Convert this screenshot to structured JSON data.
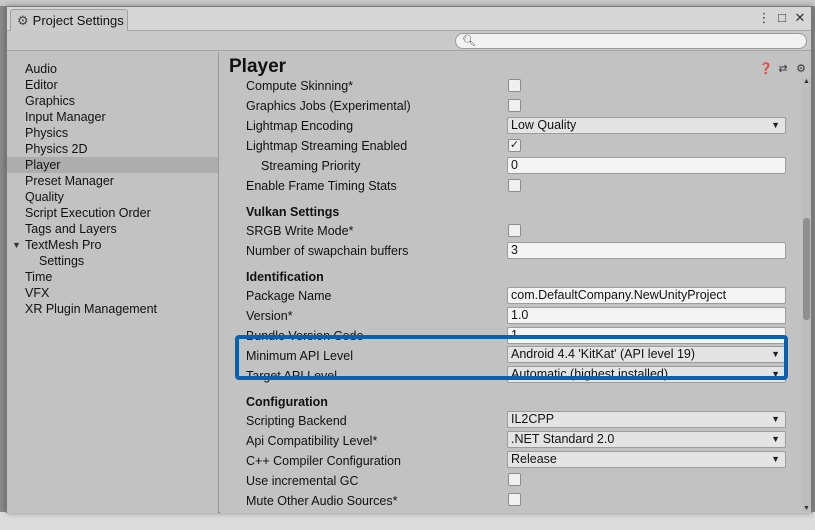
{
  "window": {
    "title": "Project Settings",
    "buttons": [
      "⋮",
      "□",
      "✕"
    ]
  },
  "search": {
    "placeholder": ""
  },
  "sidebar": {
    "items": [
      {
        "label": "Audio"
      },
      {
        "label": "Editor"
      },
      {
        "label": "Graphics"
      },
      {
        "label": "Input Manager"
      },
      {
        "label": "Physics"
      },
      {
        "label": "Physics 2D"
      },
      {
        "label": "Player",
        "selected": true
      },
      {
        "label": "Preset Manager"
      },
      {
        "label": "Quality"
      },
      {
        "label": "Script Execution Order"
      },
      {
        "label": "Tags and Layers"
      },
      {
        "label": "TextMesh Pro",
        "expanded": true
      },
      {
        "label": "Settings",
        "child": true
      },
      {
        "label": "Time"
      },
      {
        "label": "VFX"
      },
      {
        "label": "XR Plugin Management"
      }
    ]
  },
  "main": {
    "title": "Player",
    "header_icons": [
      "help-icon",
      "sliders-icon",
      "gear-icon"
    ],
    "rows": {
      "compute_skinning": {
        "label": "Compute Skinning*",
        "checked": false
      },
      "graphics_jobs": {
        "label": "Graphics Jobs (Experimental)",
        "checked": false
      },
      "lightmap_encoding": {
        "label": "Lightmap Encoding",
        "value": "Low Quality"
      },
      "lightmap_streaming": {
        "label": "Lightmap Streaming Enabled",
        "checked": true,
        "mark": "✓"
      },
      "streaming_priority": {
        "label": "Streaming Priority",
        "value": "0"
      },
      "frame_timing": {
        "label": "Enable Frame Timing Stats",
        "checked": false
      },
      "vulkan_header": "Vulkan Settings",
      "srgb_write": {
        "label": "SRGB Write Mode*",
        "checked": false
      },
      "swapchain": {
        "label": "Number of swapchain buffers",
        "value": "3"
      },
      "identification_header": "Identification",
      "package_name": {
        "label": "Package Name",
        "value": "com.DefaultCompany.NewUnityProject"
      },
      "version": {
        "label": "Version*",
        "value": "1.0"
      },
      "bundle_code": {
        "label": "Bundle Version Code",
        "value": "1"
      },
      "min_api": {
        "label": "Minimum API Level",
        "value": "Android 4.4 'KitKat' (API level 19)"
      },
      "target_api": {
        "label": "Target API Level",
        "value": "Automatic (highest installed)"
      },
      "configuration_header": "Configuration",
      "scripting_backend": {
        "label": "Scripting Backend",
        "value": "IL2CPP"
      },
      "api_compat": {
        "label": "Api Compatibility Level*",
        "value": ".NET Standard 2.0"
      },
      "cpp_config": {
        "label": "C++ Compiler Configuration",
        "value": "Release"
      },
      "incremental_gc": {
        "label": "Use incremental GC",
        "checked": false
      },
      "mute_audio": {
        "label": "Mute Other Audio Sources*",
        "checked": false
      }
    }
  },
  "colors": {
    "highlight": "#0a60b0",
    "selected": "#adadad"
  }
}
